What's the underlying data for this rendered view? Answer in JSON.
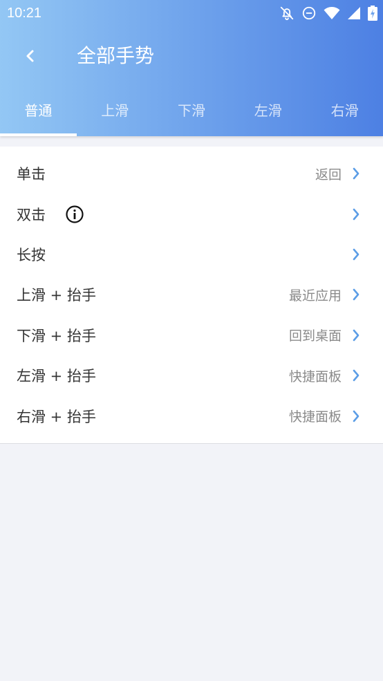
{
  "status_bar": {
    "time": "10:21",
    "icons": [
      "notifications-off-icon",
      "do-not-disturb-icon",
      "wifi-icon",
      "signal-icon",
      "battery-charging-icon"
    ]
  },
  "header": {
    "title": "全部手势",
    "back_icon": "chevron-left-icon"
  },
  "tabs": [
    {
      "label": "普通",
      "active": true
    },
    {
      "label": "上滑",
      "active": false
    },
    {
      "label": "下滑",
      "active": false
    },
    {
      "label": "左滑",
      "active": false
    },
    {
      "label": "右滑",
      "active": false
    }
  ],
  "gestures": [
    {
      "label": "单击",
      "value": "返回"
    },
    {
      "label": "双击",
      "value": "",
      "has_info": true
    },
    {
      "label": "长按",
      "value": ""
    },
    {
      "label": "上滑 + 抬手",
      "value": "最近应用"
    },
    {
      "label": "下滑 + 抬手",
      "value": "回到桌面"
    },
    {
      "label": "左滑 + 抬手",
      "value": "快捷面板"
    },
    {
      "label": "右滑 + 抬手",
      "value": "快捷面板"
    }
  ],
  "colors": {
    "header_gradient_start": "#93c7f4",
    "header_gradient_end": "#4d80e3",
    "chevron": "#5b9de6",
    "background": "#f2f3f8"
  }
}
